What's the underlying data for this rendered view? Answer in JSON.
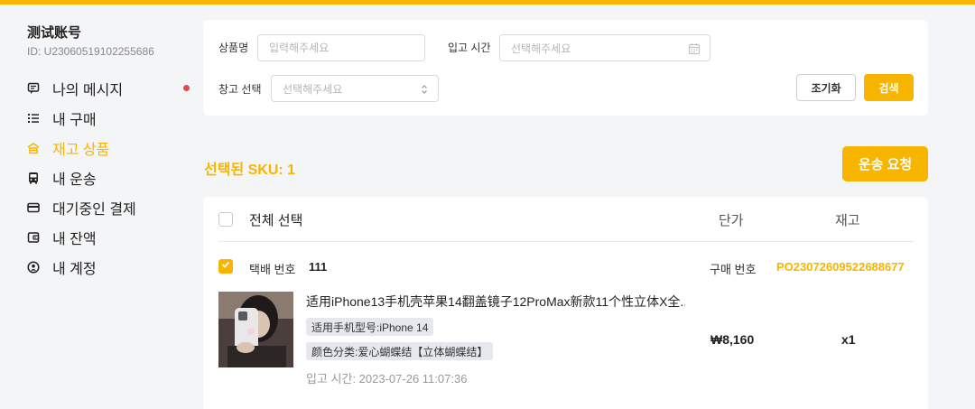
{
  "account": {
    "name": "测试账号",
    "id": "ID: U2306051910225568​6"
  },
  "nav": [
    {
      "label": "나의 메시지",
      "icon": "message-icon",
      "active": false,
      "dot": true
    },
    {
      "label": "내 구매",
      "icon": "list-icon",
      "active": false,
      "dot": false
    },
    {
      "label": "재고 상품",
      "icon": "warehouse-icon",
      "active": true,
      "dot": false
    },
    {
      "label": "내 운송",
      "icon": "bus-icon",
      "active": false,
      "dot": false
    },
    {
      "label": "대기중인 결제",
      "icon": "card-icon",
      "active": false,
      "dot": false
    },
    {
      "label": "내 잔액",
      "icon": "wallet-icon",
      "active": false,
      "dot": false
    },
    {
      "label": "내 계정",
      "icon": "user-icon",
      "active": false,
      "dot": false
    }
  ],
  "colors": {
    "accent": "#f8b500",
    "notify_dot": "#e5484d"
  },
  "filter": {
    "product_name_label": "상품명",
    "product_name_placeholder": "입력해주세요",
    "in_time_label": "입고 시간",
    "in_time_placeholder": "선택해주세요",
    "warehouse_label": "창고 선택",
    "warehouse_placeholder": "선택해주세요",
    "reset_label": "조기화",
    "search_label": "검색"
  },
  "selection": {
    "selected_text": "선택된 SKU: 1",
    "ship_request_label": "운송 요청"
  },
  "table": {
    "select_all_label": "전체 선택",
    "price_header": "단가",
    "stock_header": "재고"
  },
  "item": {
    "tracking_label": "택배 번호",
    "tracking_value": "111",
    "po_label": "구매 번호",
    "po_value": "PO23072609522688677",
    "title": "适用iPhone13手机壳苹果14翻盖镜子12ProMax新款11个性立体X全...",
    "tags": [
      "适用手机型号:iPhone 14",
      "颜色分类:爱心蝴蝶结【立体蝴蝶结】"
    ],
    "in_time": "입고 시간: 2023-07-26 11:07:36",
    "price": "₩8,160",
    "qty": "x1",
    "checked": true
  }
}
